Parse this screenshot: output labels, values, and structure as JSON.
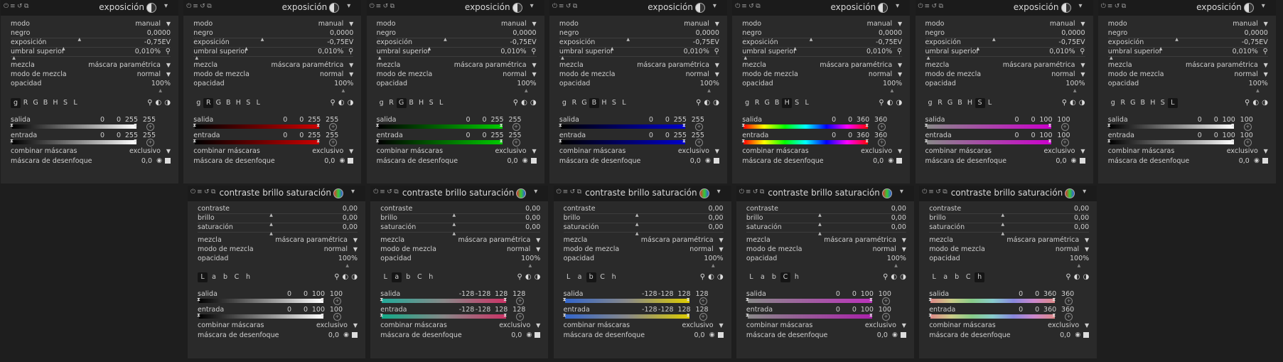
{
  "exposure_panels": [
    {
      "title": "exposición",
      "modo": "manual",
      "negro": "0,0000",
      "exposicion": "-0,75EV",
      "umbral": "0,010%",
      "mezcla": "máscara paramétrica",
      "modo_mezcla": "normal",
      "opacidad": "100%",
      "active_tab": 0,
      "tabs": [
        "g",
        "R",
        "G",
        "B",
        "H",
        "S",
        "L"
      ],
      "salida": [
        "0",
        "0",
        "255",
        "255"
      ],
      "entrada": [
        "0",
        "0",
        "255",
        "255"
      ],
      "combinar": "exclusivo",
      "desenfoque": "0,0",
      "grad_out": "linear-gradient(90deg,#000,#fff)",
      "grad_in": "linear-gradient(90deg,#000,#fff)"
    },
    {
      "title": "exposición",
      "modo": "manual",
      "negro": "0,0000",
      "exposicion": "-0,75EV",
      "umbral": "0,010%",
      "mezcla": "máscara paramétrica",
      "modo_mezcla": "normal",
      "opacidad": "100%",
      "active_tab": 1,
      "tabs": [
        "g",
        "R",
        "G",
        "B",
        "H",
        "S",
        "L"
      ],
      "salida": [
        "0",
        "0",
        "255",
        "255"
      ],
      "entrada": [
        "0",
        "0",
        "255",
        "255"
      ],
      "combinar": "exclusivo",
      "desenfoque": "0,0",
      "grad_out": "linear-gradient(90deg,#000,#c00)",
      "grad_in": "linear-gradient(90deg,#000,#c00)"
    },
    {
      "title": "exposición",
      "modo": "manual",
      "negro": "0,0000",
      "exposicion": "-0,75EV",
      "umbral": "0,010%",
      "mezcla": "máscara paramétrica",
      "modo_mezcla": "normal",
      "opacidad": "100%",
      "active_tab": 2,
      "tabs": [
        "g",
        "R",
        "G",
        "B",
        "H",
        "S",
        "L"
      ],
      "salida": [
        "0",
        "0",
        "255",
        "255"
      ],
      "entrada": [
        "0",
        "0",
        "255",
        "255"
      ],
      "combinar": "exclusivo",
      "desenfoque": "0,0",
      "grad_out": "linear-gradient(90deg,#000,#0c0)",
      "grad_in": "linear-gradient(90deg,#000,#0c0)"
    },
    {
      "title": "exposición",
      "modo": "manual",
      "negro": "0,0000",
      "exposicion": "-0,75EV",
      "umbral": "0,010%",
      "mezcla": "máscara paramétrica",
      "modo_mezcla": "normal",
      "opacidad": "100%",
      "active_tab": 3,
      "tabs": [
        "g",
        "R",
        "G",
        "B",
        "H",
        "S",
        "L"
      ],
      "salida": [
        "0",
        "0",
        "255",
        "255"
      ],
      "entrada": [
        "0",
        "0",
        "255",
        "255"
      ],
      "combinar": "exclusivo",
      "desenfoque": "0,0",
      "grad_out": "linear-gradient(90deg,#000,#00c)",
      "grad_in": "linear-gradient(90deg,#000,#00c)"
    },
    {
      "title": "exposición",
      "modo": "manual",
      "negro": "0,0000",
      "exposicion": "-0,75EV",
      "umbral": "0,010%",
      "mezcla": "máscara paramétrica",
      "modo_mezcla": "normal",
      "opacidad": "100%",
      "active_tab": 4,
      "tabs": [
        "g",
        "R",
        "G",
        "B",
        "H",
        "S",
        "L"
      ],
      "salida": [
        "0",
        "0",
        "360",
        "360"
      ],
      "entrada": [
        "0",
        "0",
        "360",
        "360"
      ],
      "combinar": "exclusivo",
      "desenfoque": "0,0",
      "grad_out": "linear-gradient(90deg,#f00,#ff0,#0f0,#0ff,#00f,#f0f,#f00)",
      "grad_in": "linear-gradient(90deg,#f00,#ff0,#0f0,#0ff,#00f,#f0f,#f00)"
    },
    {
      "title": "exposición",
      "modo": "manual",
      "negro": "0,0000",
      "exposicion": "-0,75EV",
      "umbral": "0,010%",
      "mezcla": "máscara paramétrica",
      "modo_mezcla": "normal",
      "opacidad": "100%",
      "active_tab": 5,
      "tabs": [
        "g",
        "R",
        "G",
        "B",
        "H",
        "S",
        "L"
      ],
      "salida": [
        "0",
        "0",
        "100",
        "100"
      ],
      "entrada": [
        "0",
        "0",
        "100",
        "100"
      ],
      "combinar": "exclusivo",
      "desenfoque": "0,0",
      "grad_out": "linear-gradient(90deg,#888,#c0c)",
      "grad_in": "linear-gradient(90deg,#888,#c0c)"
    },
    {
      "title": "exposición",
      "modo": "manual",
      "negro": "0,0000",
      "exposicion": "-0,75EV",
      "umbral": "0,010%",
      "mezcla": "máscara paramétrica",
      "modo_mezcla": "normal",
      "opacidad": "100%",
      "active_tab": 6,
      "tabs": [
        "g",
        "R",
        "G",
        "B",
        "H",
        "S",
        "L"
      ],
      "salida": [
        "0",
        "0",
        "100",
        "100"
      ],
      "entrada": [
        "0",
        "0",
        "100",
        "100"
      ],
      "combinar": "exclusivo",
      "desenfoque": "0,0",
      "grad_out": "linear-gradient(90deg,#000,#fff)",
      "grad_in": "linear-gradient(90deg,#000,#fff)"
    }
  ],
  "cbs_panels": [
    {
      "title": "contraste brillo saturación",
      "contraste": "0,00",
      "brillo": "0,00",
      "saturacion": "0,00",
      "mezcla": "máscara paramétrica",
      "modo_mezcla": "normal",
      "opacidad": "100%",
      "active_tab": 0,
      "tabs": [
        "L",
        "a",
        "b",
        "C",
        "h"
      ],
      "salida": [
        "0",
        "0",
        "100",
        "100"
      ],
      "entrada": [
        "0",
        "0",
        "100",
        "100"
      ],
      "combinar": "exclusivo",
      "desenfoque": "0,0",
      "grad_out": "linear-gradient(90deg,#000,#fff)",
      "grad_in": "linear-gradient(90deg,#000,#fff)"
    },
    {
      "title": "contraste brillo saturación",
      "contraste": "0,00",
      "brillo": "0,00",
      "saturacion": "0,00",
      "mezcla": "máscara paramétrica",
      "modo_mezcla": "normal",
      "opacidad": "100%",
      "active_tab": 1,
      "tabs": [
        "L",
        "a",
        "b",
        "C",
        "h"
      ],
      "salida": [
        "-128",
        "-128",
        "128",
        "128"
      ],
      "entrada": [
        "-128",
        "-128",
        "128",
        "128"
      ],
      "combinar": "exclusivo",
      "desenfoque": "0,0",
      "grad_out": "linear-gradient(90deg,#2a9,#888,#c36)",
      "grad_in": "linear-gradient(90deg,#1a8,#888,#c36)"
    },
    {
      "title": "contraste brillo saturación",
      "contraste": "0,00",
      "brillo": "0,00",
      "saturacion": "0,00",
      "mezcla": "máscara paramétrica",
      "modo_mezcla": "normal",
      "opacidad": "100%",
      "active_tab": 2,
      "tabs": [
        "L",
        "a",
        "b",
        "C",
        "h"
      ],
      "salida": [
        "-128",
        "-128",
        "128",
        "128"
      ],
      "entrada": [
        "-128",
        "-128",
        "128",
        "128"
      ],
      "combinar": "exclusivo",
      "desenfoque": "0,0",
      "grad_out": "linear-gradient(90deg,#36c,#888,#dc0)",
      "grad_in": "linear-gradient(90deg,#36c,#888,#dc0)"
    },
    {
      "title": "contraste brillo saturación",
      "contraste": "0,00",
      "brillo": "0,00",
      "saturacion": "0,00",
      "mezcla": "máscara paramétrica",
      "modo_mezcla": "normal",
      "opacidad": "100%",
      "active_tab": 3,
      "tabs": [
        "L",
        "a",
        "b",
        "C",
        "h"
      ],
      "salida": [
        "0",
        "0",
        "100",
        "100"
      ],
      "entrada": [
        "0",
        "0",
        "100",
        "100"
      ],
      "combinar": "exclusivo",
      "desenfoque": "0,0",
      "grad_out": "linear-gradient(90deg,#888,#b3b)",
      "grad_in": "linear-gradient(90deg,#888,#a2a)"
    },
    {
      "title": "contraste brillo saturación",
      "contraste": "0,00",
      "brillo": "0,00",
      "saturacion": "0,00",
      "mezcla": "máscara paramétrica",
      "modo_mezcla": "normal",
      "opacidad": "100%",
      "active_tab": 4,
      "tabs": [
        "L",
        "a",
        "b",
        "C",
        "h"
      ],
      "salida": [
        "0",
        "0",
        "360",
        "360"
      ],
      "entrada": [
        "0",
        "0",
        "360",
        "360"
      ],
      "combinar": "exclusivo",
      "desenfoque": "0,0",
      "grad_out": "linear-gradient(90deg,#d88,#cc8,#8c8,#8cc,#88d,#c8c,#d88)",
      "grad_in": "linear-gradient(90deg,#d88,#cc8,#8c8,#8cc,#88d,#c8c,#d88)"
    }
  ],
  "labels": {
    "modo": "modo",
    "negro": "negro",
    "exposicion": "exposición",
    "umbral": "umbral superior",
    "mezcla": "mezcla",
    "modo_mezcla": "modo de mezcla",
    "opacidad": "opacidad",
    "salida": "salida",
    "entrada": "entrada",
    "combinar": "combinar máscaras",
    "desenfoque": "máscara de desenfoque",
    "contraste": "contraste",
    "brillo": "brillo",
    "saturacion": "saturación"
  }
}
